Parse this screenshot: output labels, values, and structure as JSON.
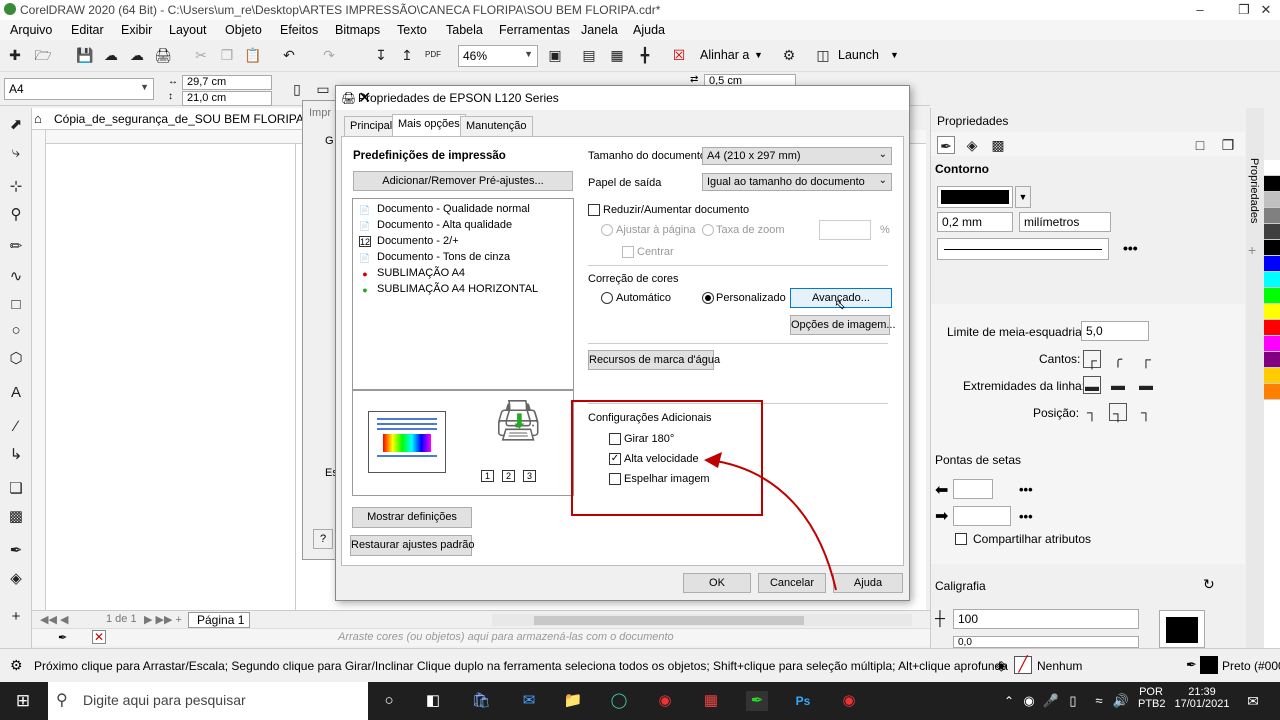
{
  "window": {
    "title": "CorelDRAW 2020 (64 Bit) - C:\\Users\\um_re\\Desktop\\ARTES IMPRESSÃO\\CANECA FLORIPA\\SOU BEM FLORIPA.cdr*"
  },
  "menu": [
    "Arquivo",
    "Editar",
    "Exibir",
    "Layout",
    "Objeto",
    "Efeitos",
    "Bitmaps",
    "Texto",
    "Tabela",
    "Ferramentas",
    "Janela",
    "Ajuda"
  ],
  "toolbar": {
    "zoom": "46%",
    "align": "Alinhar a",
    "launch": "Launch",
    "pdf": "PDF"
  },
  "propbar": {
    "page_size": "A4",
    "width": "29,7 cm",
    "height": "21,0 cm",
    "nudge": "0,5 cm"
  },
  "doc_tab": "Cópia_de_segurança_de_SOU BEM FLORIPA.cdr*",
  "page_nav": {
    "counter": "1 de 1",
    "page_tab": "Página 1"
  },
  "color_hint": "Arraste cores (ou objetos) aqui para armazená-las com o documento",
  "status": {
    "message": "Próximo clique para Arrastar/Escala; Segundo clique para Girar/Inclinar Clique duplo na ferramenta seleciona todos os objetos; Shift+clique para seleção múltipla; Alt+clique aprofunda",
    "fill": "Nenhum",
    "outline": "Preto (#000"
  },
  "props": {
    "title": "Propriedades",
    "vtab": "Propriedades",
    "contorno": "Contorno",
    "width": "0,2 mm",
    "units": "milímetros",
    "miter_label": "Limite de meia-esquadria:",
    "miter": "5,0",
    "corners": "Cantos:",
    "caps": "Extremidades da linha:",
    "position": "Posição:",
    "arrows": "Pontas de setas",
    "share": "Compartilhar atributos",
    "calligraphy": "Caligrafia",
    "stretch": "100",
    "angle": "0,0"
  },
  "palette": [
    "#ffffff",
    "#000000",
    "#c0c0c0",
    "#808080",
    "#404040",
    "#000000",
    "#0000ff",
    "#00ffff",
    "#00ff00",
    "#ffff00",
    "#ff0000",
    "#ff00ff",
    "#800080",
    "#ffcc00",
    "#ff8000"
  ],
  "dialog": {
    "title": "Propriedades de EPSON L120 Series",
    "tabs": [
      "Principal",
      "Mais opções",
      "Manutenção"
    ],
    "presets_title": "Predefinições de impressão",
    "add_remove": "Adicionar/Remover Pré-ajustes...",
    "presets": [
      "Documento - Qualidade normal",
      "Documento - Alta qualidade",
      "Documento - 2/+",
      "Documento - Tons de cinza",
      "SUBLIMAÇÃO A4",
      "SUBLIMAÇÃO A4 HORIZONTAL"
    ],
    "doc_size_label": "Tamanho do documento",
    "doc_size": "A4 (210 x 297 mm)",
    "output_label": "Papel de saída",
    "output": "Igual ao tamanho do documento",
    "reduce": "Reduzir/Aumentar documento",
    "fit": "Ajustar à página",
    "zoom_rate": "Taxa de zoom",
    "percent": "%",
    "center": "Centrar",
    "color_corr": "Correção de cores",
    "auto": "Automático",
    "custom": "Personalizado",
    "advanced": "Avançado...",
    "image_opts": "Opções de imagem...",
    "watermark": "Recursos de marca d'água",
    "extra": "Configurações Adicionais",
    "rotate": "Girar 180°",
    "highspeed": "Alta velocidade",
    "mirror": "Espelhar imagem",
    "show_settings": "Mostrar definições",
    "restore": "Restaurar ajustes padrão",
    "ok": "OK",
    "cancel": "Cancelar",
    "help": "Ajuda",
    "copies": [
      "1",
      "2",
      "3"
    ]
  },
  "bg_dialog": {
    "label": "Impr",
    "g": "G",
    "e": "Es",
    "q": "?"
  },
  "taskbar": {
    "search": "Digite aqui para pesquisar",
    "lang": "POR",
    "lang2": "PTB2",
    "time": "21:39",
    "date": "17/01/2021"
  },
  "colors": {
    "accent": "#0078d7",
    "highlight": "#c00000"
  }
}
